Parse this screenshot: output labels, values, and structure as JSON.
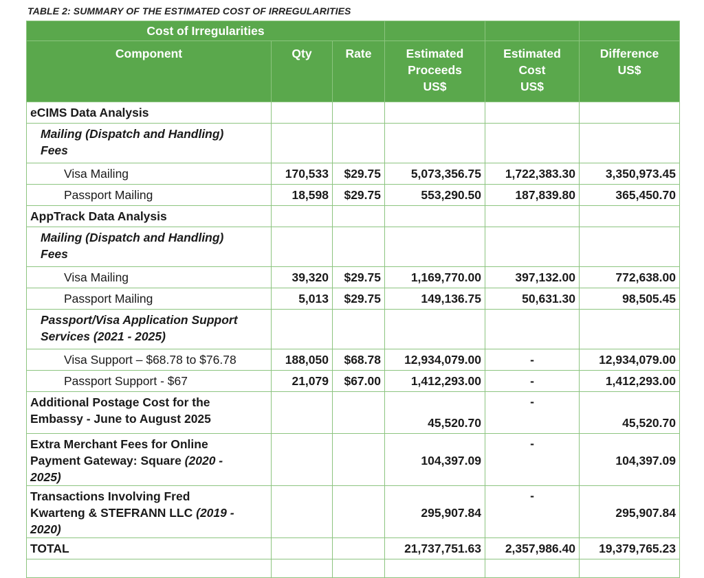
{
  "caption": "TABLE 2: SUMMARY OF THE ESTIMATED COST OF IRREGULARITIES",
  "header": {
    "group": "Cost of Irregularities",
    "component": "Component",
    "qty": "Qty",
    "rate": "Rate",
    "proceeds": [
      "Estimated",
      "Proceeds",
      "US$"
    ],
    "cost": [
      "Estimated",
      "Cost",
      "US$"
    ],
    "difference": [
      "Difference",
      "US$"
    ]
  },
  "rows": {
    "ecims": "eCIMS Data Analysis",
    "ecims_mail_1": "Mailing (Dispatch and Handling)",
    "ecims_mail_2": "Fees",
    "ecims_visa": {
      "label": "Visa Mailing",
      "qty": "170,533",
      "rate": "$29.75",
      "proceeds": "5,073,356.75",
      "cost": "1,722,383.30",
      "diff": "3,350,973.45"
    },
    "ecims_pass": {
      "label": "Passport Mailing",
      "qty": "18,598",
      "rate": "$29.75",
      "proceeds": "553,290.50",
      "cost": "187,839.80",
      "diff": "365,450.70"
    },
    "apptrack": "AppTrack Data Analysis",
    "app_mail_1": "Mailing (Dispatch and Handling)",
    "app_mail_2": "Fees",
    "app_visa": {
      "label": "Visa Mailing",
      "qty": "39,320",
      "rate": "$29.75",
      "proceeds": "1,169,770.00",
      "cost": "397,132.00",
      "diff": "772,638.00"
    },
    "app_pass": {
      "label": "Passport Mailing",
      "qty": "5,013",
      "rate": "$29.75",
      "proceeds": "149,136.75",
      "cost": "50,631.30",
      "diff": "98,505.45"
    },
    "support_1": "Passport/Visa Application Support",
    "support_2": "Services (2021 - 2025)",
    "visa_support": {
      "label": "Visa Support – $68.78 to $76.78",
      "qty": "188,050",
      "rate": "$68.78",
      "proceeds": "12,934,079.00",
      "cost": "-",
      "diff": "12,934,079.00"
    },
    "pass_support": {
      "label": "Passport Support - $67",
      "qty": "21,079",
      "rate": "$67.00",
      "proceeds": "1,412,293.00",
      "cost": "-",
      "diff": "1,412,293.00"
    },
    "postage": {
      "line1": "Additional Postage Cost for the",
      "line2": "Embassy - June to August 2025",
      "proceeds": "45,520.70",
      "cost": "-",
      "diff": "45,520.70"
    },
    "merchant": {
      "line1": "Extra Merchant Fees for Online",
      "line2a": "Payment Gateway: Square ",
      "line2b": "(2020 -",
      "line3": "2025)",
      "proceeds": "104,397.09",
      "cost": "-",
      "diff": "104,397.09"
    },
    "fred": {
      "line1": "Transactions Involving Fred",
      "line2a": "Kwarteng & STEFRANN LLC ",
      "line2b": "(2019 -",
      "line3": "2020)",
      "proceeds": "295,907.84",
      "cost": "-",
      "diff": "295,907.84"
    },
    "total": {
      "label": "TOTAL",
      "proceeds": "21,737,751.63",
      "cost": "2,357,986.40",
      "diff": "19,379,765.23"
    }
  },
  "colors": {
    "header_bg": "#5aa84c",
    "grid": "#8cc47f"
  }
}
